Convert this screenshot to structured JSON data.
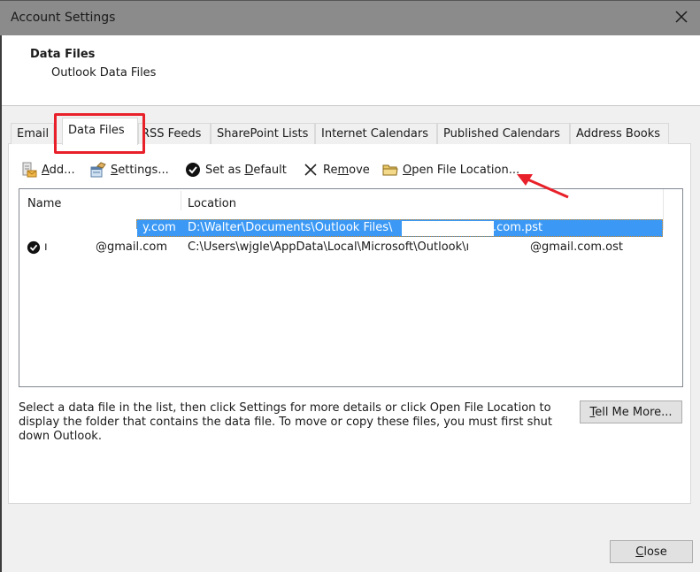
{
  "window": {
    "title": "Account Settings",
    "close_icon": "close-x-icon"
  },
  "header": {
    "title": "Data Files",
    "subtitle": "Outlook Data Files"
  },
  "tabs": [
    {
      "label": "Email",
      "active": false
    },
    {
      "label": "Data Files",
      "active": true
    },
    {
      "label": "RSS Feeds",
      "active": false
    },
    {
      "label": "SharePoint Lists",
      "active": false
    },
    {
      "label": "Internet Calendars",
      "active": false
    },
    {
      "label": "Published Calendars",
      "active": false
    },
    {
      "label": "Address Books",
      "active": false
    }
  ],
  "toolbar": {
    "add": {
      "pre": "",
      "u": "A",
      "post": "dd...",
      "icon": "add-data-file-icon"
    },
    "settings": {
      "pre": "",
      "u": "S",
      "post": "ettings...",
      "icon": "settings-icon"
    },
    "set_default": {
      "pre": "Set as ",
      "u": "D",
      "post": "efault",
      "icon": "checkmark-circle-icon"
    },
    "remove": {
      "pre": "Re",
      "u": "m",
      "post": "ove",
      "icon": "x-icon"
    },
    "open_location": {
      "pre": "",
      "u": "O",
      "post": "pen File Location...",
      "icon": "folder-icon"
    }
  },
  "list": {
    "columns": [
      "Name",
      "Location"
    ],
    "rows": [
      {
        "name": "y.com",
        "location_a": "D:\\Walter\\Documents\\Outlook Files\\",
        "location_b": ".com.pst",
        "default": false,
        "selected": true
      },
      {
        "name_a": "ı",
        "name": "@gmail.com",
        "location_a": "C:\\Users\\wjgle\\AppData\\Local\\Microsoft\\Outlook\\ı",
        "location_b": "@gmail.com.ost",
        "default": true,
        "selected": false
      }
    ]
  },
  "description": "Select a data file in the list, then click Settings for more details or click Open File Location to display the folder that contains the data file. To move or copy these files, you must first shut down Outlook.",
  "buttons": {
    "tell_me_more": {
      "u": "T",
      "post": "ell Me More..."
    },
    "close": {
      "u": "C",
      "post": "lose"
    }
  },
  "annotation": {
    "highlight_color": "#e8202a",
    "selection_color": "#3b99f5"
  }
}
